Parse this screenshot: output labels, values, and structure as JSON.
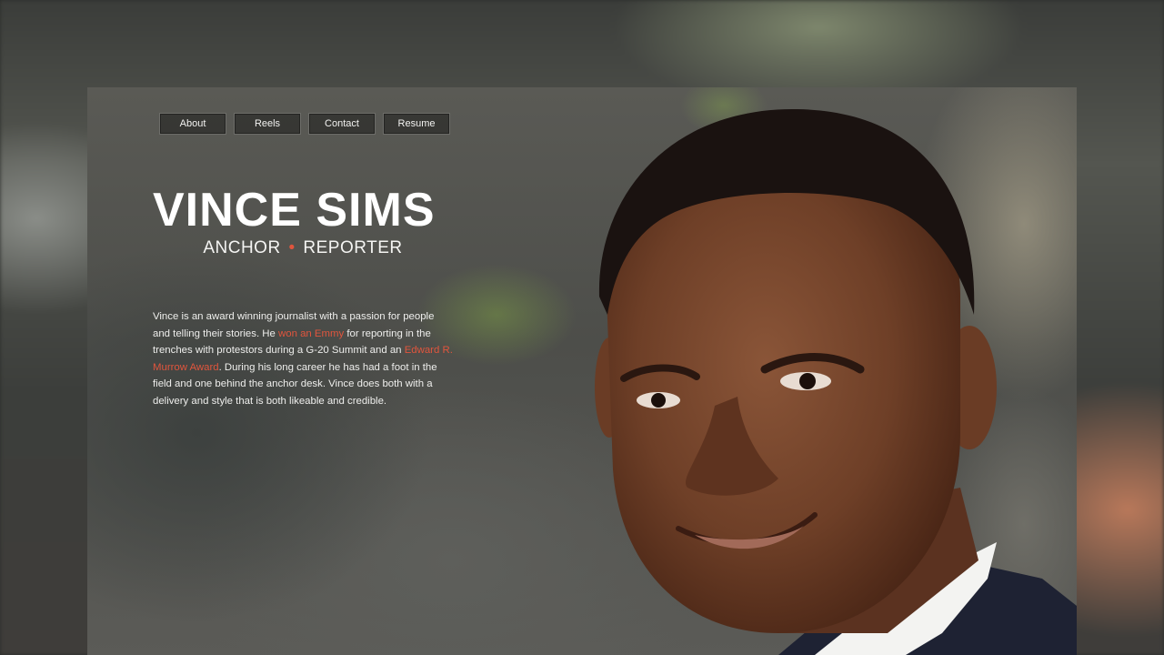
{
  "nav": {
    "items": [
      {
        "label": "About"
      },
      {
        "label": "Reels"
      },
      {
        "label": "Contact"
      },
      {
        "label": "Resume"
      }
    ]
  },
  "hero": {
    "name": "VINCE SIMS",
    "role_left": "ANCHOR",
    "role_separator": "•",
    "role_right": "REPORTER"
  },
  "bio": {
    "part1": "Vince is an award winning journalist with a passion for people and telling their stories.  He ",
    "link1": "won an Emmy",
    "part2": " for reporting in the trenches with protestors during a G-20 Summit and an ",
    "link2": "Edward R. Murrow Award",
    "part3": ".  During his long career he has had a foot in the field and one behind the anchor desk. Vince does both with a delivery and style that is both likeable and credible."
  },
  "colors": {
    "accent": "#e0553d",
    "text": "#ffffff"
  }
}
